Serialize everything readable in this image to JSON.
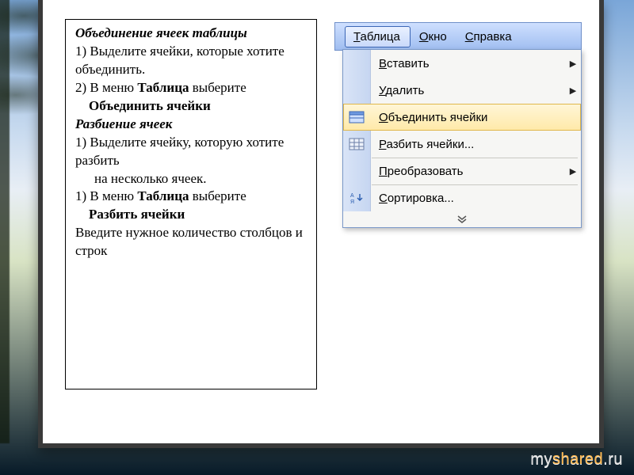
{
  "instructions": {
    "title1": "Объединение ячеек таблицы",
    "merge_steps": [
      "Выделите ячейки, которые хотите объединить.",
      "В меню "
    ],
    "merge_step2_bold1": "Таблица",
    "merge_step2_mid": " выберите ",
    "merge_step2_bold2": "Объединить ячейки",
    "title2": "Разбиение ячеек",
    "split_step1a": "Выделите ячейку, которую хотите разбить",
    "split_step1b": "на несколько ячеек.",
    "split_step2_pre": "В меню ",
    "split_step2_bold1": "Таблица",
    "split_step2_mid": " выберите ",
    "split_step2_bold2": "Разбить ячейки",
    "tail": "Введите нужное количество столбцов и строк"
  },
  "menubar": {
    "items": [
      {
        "label": "Таблица",
        "accel": "Т",
        "active": true
      },
      {
        "label": "Окно",
        "accel": "О",
        "active": false
      },
      {
        "label": "Справка",
        "accel": "С",
        "active": false
      }
    ]
  },
  "dropdown": {
    "items": [
      {
        "label": "Вставить",
        "accel": "В",
        "submenu": true,
        "icon": null
      },
      {
        "label": "Удалить",
        "accel": "У",
        "submenu": true,
        "icon": null,
        "sep_after": true
      },
      {
        "label": "Объединить ячейки",
        "accel": "О",
        "submenu": false,
        "icon": "merge",
        "highlight": true
      },
      {
        "label": "Разбить ячейки...",
        "accel": "Р",
        "submenu": false,
        "icon": "split",
        "sep_after": true
      },
      {
        "label": "Преобразовать",
        "accel": "П",
        "submenu": true,
        "icon": null,
        "sep_after": true
      },
      {
        "label": "Сортировка...",
        "accel": "С",
        "submenu": false,
        "icon": "sort"
      }
    ]
  },
  "watermark": {
    "left": "my",
    "mid": "shared",
    "right": ".ru"
  }
}
